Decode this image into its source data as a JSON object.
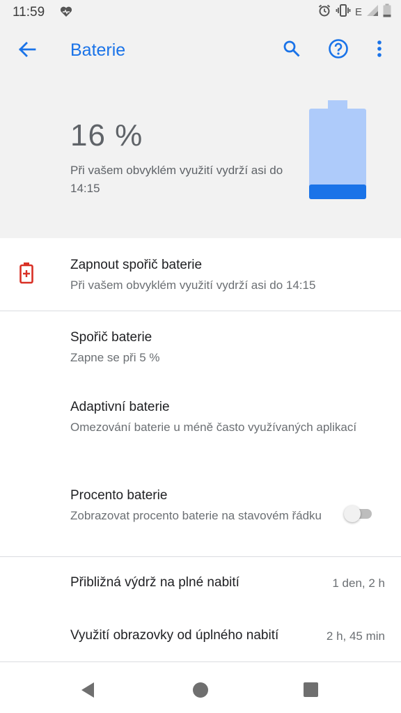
{
  "status_bar": {
    "time": "11:59",
    "network_label": "E",
    "icons": [
      "heart-icon",
      "alarm-icon",
      "vibrate-icon",
      "signal-icon",
      "battery-status-icon"
    ]
  },
  "app_bar": {
    "title": "Baterie",
    "back_icon": "arrow-back-icon",
    "search_icon": "search-icon",
    "help_icon": "help-icon",
    "more_icon": "more-vert-icon",
    "accent_color": "#1a73e8"
  },
  "header": {
    "percent": "16 %",
    "estimate": "Při vašem obvyklém využití vydrží asi do 14:15",
    "battery_level": 0.16,
    "battery_color": "#1a73e8",
    "battery_empty_color": "#aecbfa"
  },
  "items": {
    "saver_on": {
      "title": "Zapnout spořič baterie",
      "subtitle": "Při vašem obvyklém využití vydrží asi do 14:15",
      "icon": "battery-alert-icon",
      "icon_color": "#d93025"
    },
    "battery_saver": {
      "title": "Spořič baterie",
      "subtitle": "Zapne se při 5 %"
    },
    "adaptive": {
      "title": "Adaptivní baterie",
      "subtitle": "Omezování baterie u méně často využívaných aplikací"
    },
    "percentage": {
      "title": "Procento baterie",
      "subtitle": "Zobrazovat procento baterie na stavovém řádku",
      "toggle_on": false
    },
    "full_charge": {
      "title": "Přibližná výdrž na plné nabití",
      "value": "1 den, 2 h"
    },
    "screen_usage": {
      "title": "Využití obrazovky od úplného nabití",
      "value": "2 h, 45 min"
    }
  },
  "nav_bar": {
    "icons": [
      "nav-back-icon",
      "nav-home-icon",
      "nav-recents-icon"
    ]
  }
}
